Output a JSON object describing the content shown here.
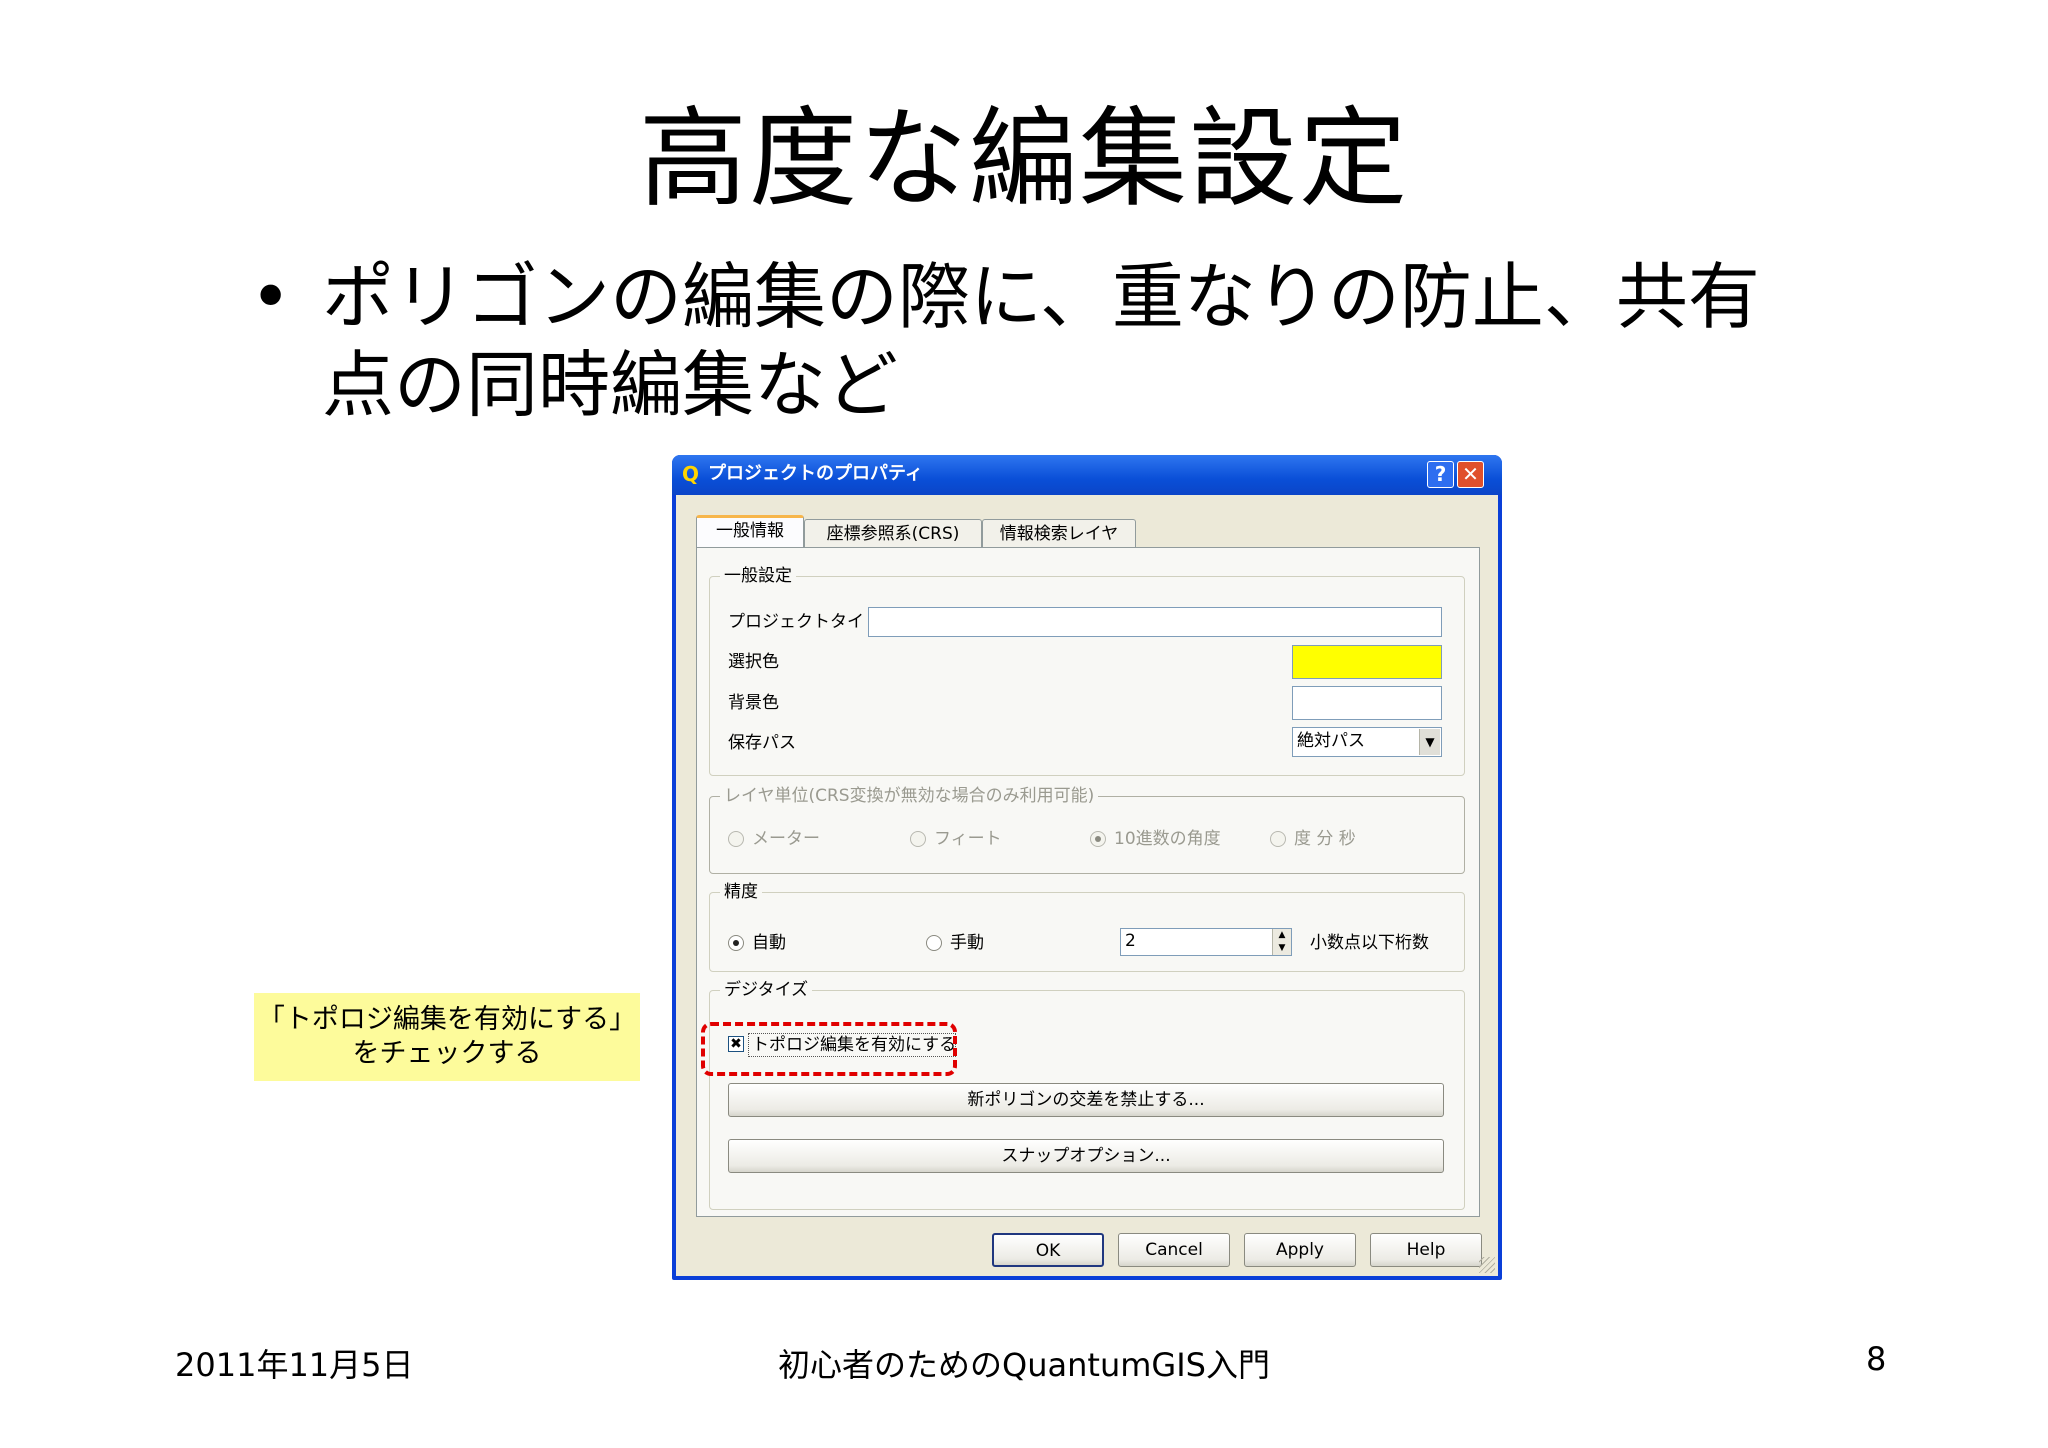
{
  "slide": {
    "title": "高度な編集設定",
    "bullet_line1": "ポリゴンの編集の際に、重なりの防止、共有",
    "bullet_line2": "点の同時編集など",
    "callout_line1": "「トポロジ編集を有効にする」",
    "callout_line2": "をチェックする",
    "footer_date": "2011年11月5日",
    "footer_title": "初心者のためのQuantumGIS入門",
    "page_number": "8"
  },
  "dialog": {
    "title": "プロジェクトのプロパティ",
    "help_glyph": "?",
    "close_glyph": "✕",
    "tabs": [
      "一般情報",
      "座標参照系(CRS)",
      "情報検索レイヤ"
    ],
    "active_tab": 0,
    "general": {
      "group_label": "一般設定",
      "project_title_label": "プロジェクトタイトル",
      "project_title_value": "",
      "selection_color_label": "選択色",
      "selection_color": "#ffff00",
      "background_color_label": "背景色",
      "background_color": "#ffffff",
      "save_paths_label": "保存パス",
      "save_paths_value": "絶対パス"
    },
    "layer_units": {
      "group_label": "レイヤ単位(CRS変換が無効な場合のみ利用可能)",
      "options": [
        "メーター",
        "フィート",
        "10進数の角度",
        "度 分 秒"
      ],
      "selected": "10進数の角度",
      "enabled": false
    },
    "precision": {
      "group_label": "精度",
      "auto_label": "自動",
      "manual_label": "手動",
      "selected": "自動",
      "decimal_places_value": "2",
      "decimal_places_label": "小数点以下桁数"
    },
    "digitizing": {
      "group_label": "デジタイズ",
      "topology_label": "トポロジ編集を有効にする",
      "topology_checked": true,
      "check_glyph": "✖",
      "avoid_intersections_button": "新ポリゴンの交差を禁止する...",
      "snapping_button": "スナップオプション..."
    },
    "buttons": {
      "ok": "OK",
      "cancel": "Cancel",
      "apply": "Apply",
      "help": "Help"
    },
    "icon_glyph": "Q",
    "combo_arrow_glyph": "▼",
    "spin_up_glyph": "▲",
    "spin_down_glyph": "▼"
  },
  "colors": {
    "callout_background": "#fdfb9b",
    "highlight_dash": "#e00000",
    "titlebar_blue": "#0a4fd8"
  }
}
